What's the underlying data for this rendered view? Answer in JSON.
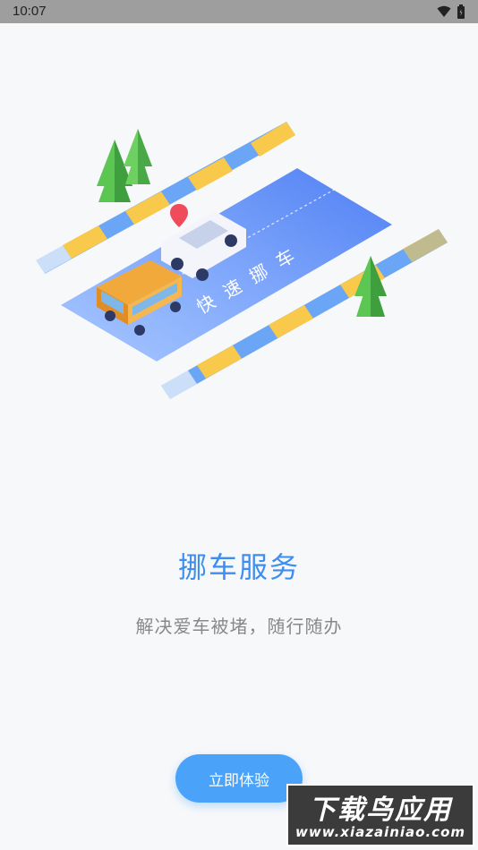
{
  "status_bar": {
    "time": "10:07",
    "icons": [
      "wifi-icon",
      "battery-icon"
    ]
  },
  "illustration": {
    "road_text": "快速挪车",
    "colors": {
      "road": "#5b8cf5",
      "road_light": "#a9c8ff",
      "stripe_blue": "#6aa6f5",
      "stripe_yellow": "#f8c94a",
      "tree": "#4fb84a",
      "car_white": "#f3f5fb",
      "van_orange": "#f2a93b",
      "pin_red": "#ef4b5a"
    }
  },
  "onboarding": {
    "title": "挪车服务",
    "subtitle": "解决爱车被堵，随行随办",
    "cta_label": "立即体验"
  },
  "watermark": {
    "title": "下载鸟应用",
    "url": "www.xiazainiao.com"
  },
  "colors": {
    "accent": "#3d8ef0",
    "button": "#4aa3f8",
    "subtitle": "#888888",
    "background": "#f7f8fa"
  }
}
